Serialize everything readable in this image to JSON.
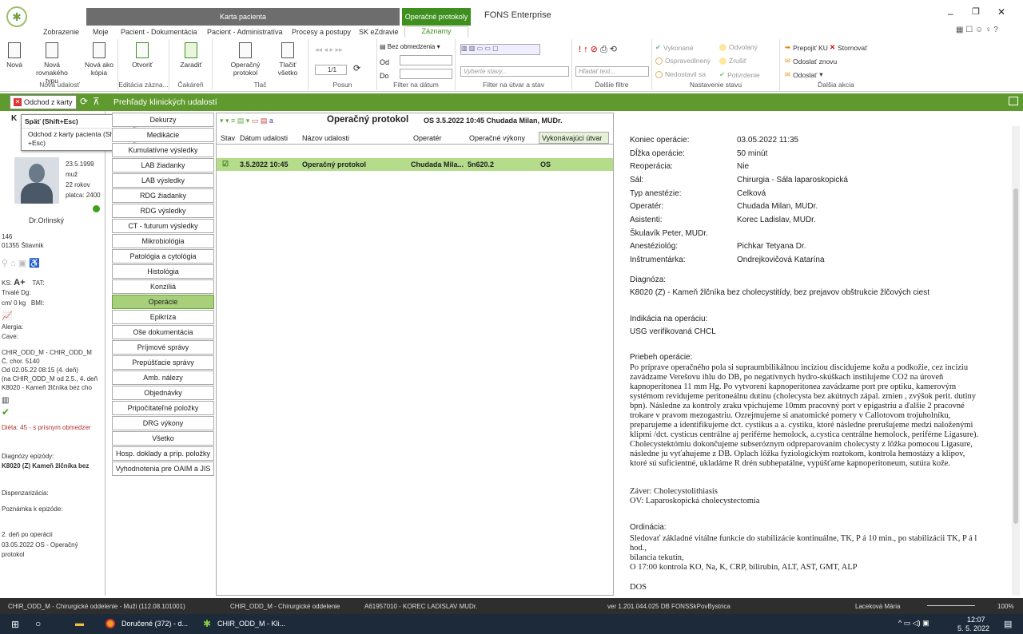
{
  "app": {
    "title": "FONS Enterprise",
    "context_tab": "Karta pacienta",
    "context_tab2": "Operačné protokoly"
  },
  "ribbon_tabs": [
    "Zobrazenie",
    "Moje",
    "Pacient - Dokumentácia",
    "Pacient - Administratíva",
    "Procesy a postupy",
    "SK eZdravie",
    "Záznamy"
  ],
  "ribbon": {
    "nova": "Nová",
    "nova_rov": "Nová rovnakého typu",
    "nova_kopia": "Nová ako kópia",
    "g_nova": "Nová udalosť",
    "otvorit": "Otvoriť",
    "zaradit": "Zaradiť",
    "g_edit": "Editácia zázna...",
    "g_cak": "Čakáreň",
    "op_protokol": "Operačný protokol",
    "tlacit": "Tlačiť všetko",
    "g_tlac": "Tlač",
    "page": "1/1",
    "g_posun": "Posun",
    "bez_obm": "Bez obmedzenia",
    "od": "Od",
    "do": "Do",
    "g_filter_datum": "Filter na dátum",
    "vyberte_stavy": "Vyberte stavy...",
    "g_filter_utvar": "Filter na útvar a stav",
    "hladat": "Hľadať text...",
    "g_dalsie": "Ďalšie filtre",
    "vykonane": "Vykonané",
    "odvolany": "Odvolaný",
    "ospravedlneny": "Ospravedlnený",
    "zrusit": "Zrušiť",
    "nedostavil": "Nedostavil sa",
    "potvrdenie": "Potvrdenie",
    "g_stav": "Nastavenie stavu",
    "prepojit": "Prepojiť KU",
    "stornovat": "Stornovať",
    "odoslat_znovu": "Odoslať znovu",
    "odoslat": "Odoslať",
    "g_akcia": "Ďalšia akcia"
  },
  "toolbar2": {
    "odchod": "Odchod z karty",
    "title": "Prehľady klinických udalostí"
  },
  "tooltip": {
    "title": "Späť (Shift+Esc)",
    "body": "Odchod z karty pacienta (Shift +Esc)"
  },
  "patient": {
    "dob": "23.5.1999",
    "sex": "muž",
    "age": "22 rokov",
    "platca": "platca: 2400",
    "doctor": "Dr.Orlinský",
    "addr1": "146",
    "addr2": "01355 Štiavnik",
    "ks": "KS:",
    "ks_val": "A+",
    "tat": "TAT:",
    "trvale": "Trvalé Dg:",
    "weight": "cm/ 0 kg",
    "bmi": "BMI:",
    "alergia": "Alergia:",
    "cave": "Cave:",
    "ep1": "CHIR_ODD_M - CHIR_ODD_M",
    "ep2": "Č. chor. 5140",
    "ep3": "Od 02.05.22 08:15 (4. deň)",
    "ep4": "(na CHIR_ODD_M od 2.5., 4. deň",
    "ep5": "K8020 - Kameň žlčníka bez cho",
    "dieta": "Diéta: 45 - s prísnym obmedzer",
    "diag_label": "Diagnózy epizódy:",
    "diag": "K8020 (Z) Kameň žlčníka bez",
    "disp": "Dispenzarizácia:",
    "pozn": "Poznámka k epizóde:",
    "den": "2. deň po operácii",
    "den2": "03.05.2022 OS  - Operačný",
    "den3": "protokol"
  },
  "nav": [
    "Dekurzy",
    "Medikácie",
    "Kumulatívne výsledky",
    "LAB žiadanky",
    "LAB výsledky",
    "RDG žiadanky",
    "RDG výsledky",
    "CT - futurum výsledky",
    "Mikrobiológia",
    "Patológia a cytológia",
    "Histológia",
    "Konzíliá",
    "Operácie",
    "Epikríza",
    "Oše dokumentácia",
    "Príjmové správy",
    "Prepúšťacie správy",
    "Amb. nálezy",
    "Objednávky",
    "Pripočítateľné položky",
    "DRG výkony",
    "Všetko",
    "Hosp. doklady a príp. položky",
    "Vyhodnotenia pre OAIM a JIS"
  ],
  "list": {
    "header_title": "Operačný protokol",
    "header_info": "OS  3.5.2022 10:45  Chudada Milan, MUDr.",
    "columns": [
      "Stav",
      "Dátum udalosti",
      "Názov udalosti",
      "Operatér",
      "Operačné výkony",
      "Vykonávajúci útvar"
    ],
    "row": {
      "date": "3.5.2022 10:45",
      "name": "Operačný protokol",
      "operater": "Chudada Mila...",
      "vykony": "5n620.2",
      "utvar": "OS"
    }
  },
  "detail": {
    "rows": [
      [
        "Koniec operácie:",
        "03.05.2022 11:35"
      ],
      [
        "Dĺžka operácie:",
        "50 minút"
      ],
      [
        "Reoperácia:",
        "Nie"
      ],
      [
        "Sál:",
        "Chirurgia - Sála laparoskopická"
      ],
      [
        "Typ anestézie:",
        "Celková"
      ],
      [
        "Operatér:",
        "Chudada Milan, MUDr."
      ],
      [
        "Asistenti:",
        "Korec Ladislav, MUDr."
      ]
    ],
    "asist2": "Škulavík Peter, MUDr.",
    "anest_l": "Anestéziológ:",
    "anest_v": "Pichkar Tetyana Dr.",
    "instr_l": "Inštrumentárka:",
    "instr_v": "Ondrejkovičová Katarína",
    "diag_l": "Diagnóza:",
    "diag_v": "K8020    (Z) - Kameň žlčníka bez cholecystitídy, bez prejavov obštrukcie žlčových ciest",
    "ind_l": "Indikácia na operáciu:",
    "ind_v": "USG verifikovaná CHCL",
    "prieb_l": "Priebeh operácie:",
    "prieb": [
      "Po príprave operačného pola si supraumbilikálnou incíziou discidujeme kožu a podkožie, cez incíziu",
      "zavádzame  Verešovu ihlu  do DB, po negatívnych hydro-skúškach instilujeme CO2 na úroveň",
      "kapnoperitonea 11 mm Hg. Po vytvorení kapnoperitonea zavádzame port pre optiku,  kamerovým",
      "systémom revidujeme peritoneálnu dutinu (cholecysta bez akútnych zápal. zmien , zvýšok perit. dutiny",
      "bpn). Následne za  kontroly zraku vpichujeme 10mm pracovný port v epigastriu a ďalšie 2 pracovné",
      "trokare v pravom mezogastriu. Ozrejmujeme si anatomické pomery  v Callotovom trojuholníku,",
      "preparujeme  a  identifikujeme dct. cystikus a a. cystiku, ktoré následne prerušujeme medzi naloženými",
      "klipmi /dct. cysticus centrálne aj periférne hemolock, a.cystica centrálne hemolock, periférne Ligasure).",
      "Cholecystektómiu dokončujeme subseróznym odpreparovaním cholecysty z lôžka pomocou Ligasure,",
      "následne ju vyťahujeme z DB. Oplach lôžka fyziologickým roztokom, kontrola hemostázy a klipov,",
      "ktoré sú suficientné, ukladáme R drén subhepatálne, vypúšťame  kapnoperitoneum, sutúra  kože."
    ],
    "zaver": "Záver: Cholecystolithiasis",
    "ov": "OV: Laparoskopická cholecystectomia",
    "ord_l": "Ordinácia:",
    "ord": [
      "Sledovať základné vitálne funkcie do stabilizácie kontinuálne, TK, P á 10 min.,  po stabilizácii TK, P á l",
      "hod.,",
      "bilancia tekutín,",
      "O 17:00 kontrola KO, Na, K, CRP, bilirubin, ALT, AST, GMT, ALP"
    ],
    "dos": "DOS"
  },
  "statusbar": {
    "s1": "CHIR_ODD_M - Chirurgické oddelenie - Muži (112.08.101001)",
    "s2": "CHIR_ODD_M - Chirurgické oddelenie",
    "s3": "A61957010 - KOREC LADISLAV MUDr.",
    "s4": "ver 1.201.044.025 DB FONSSkPovBystrica",
    "user": "Laceková Mária",
    "zoom": "100%"
  },
  "taskbar": {
    "chrome": "Doručené (372) - d...",
    "fons": "CHIR_ODD_M - Kli...",
    "time": "12:07",
    "date": "5. 5. 2022"
  },
  "colors": {
    "green": "#5e9a2e",
    "ctx_tab": "#6d6d6d",
    "ctx_green": "#3f8f1f",
    "active_nav": "#a8d07a",
    "row_sel": "#b5dc8a"
  }
}
